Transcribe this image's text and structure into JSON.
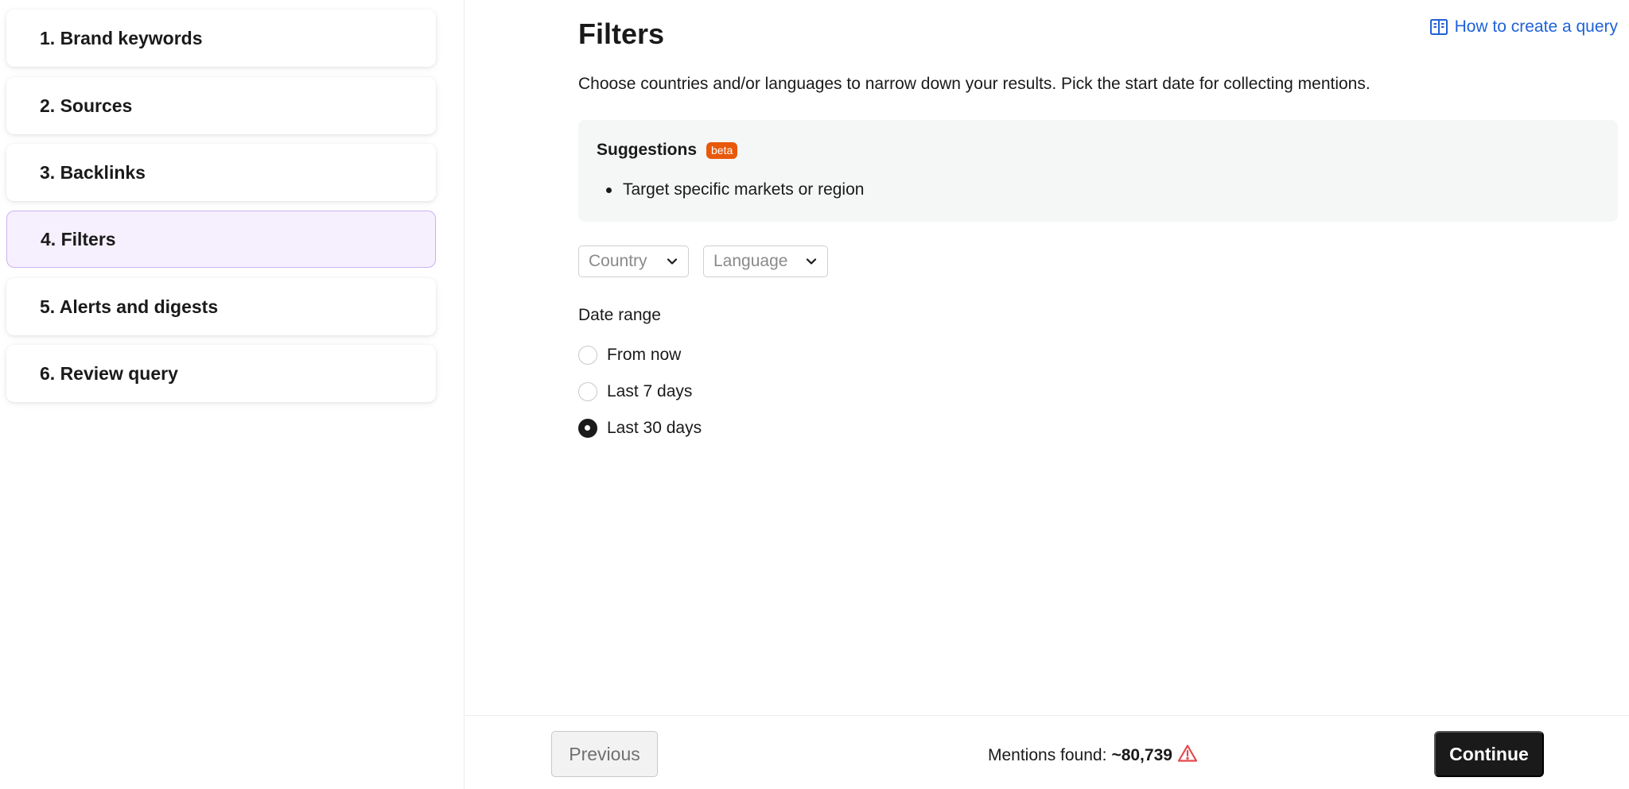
{
  "sidebar": {
    "steps": [
      {
        "label": "1. Brand keywords"
      },
      {
        "label": "2. Sources"
      },
      {
        "label": "3. Backlinks"
      },
      {
        "label": "4. Filters"
      },
      {
        "label": "5. Alerts and digests"
      },
      {
        "label": "6. Review query"
      }
    ],
    "active_step": "4. Filters"
  },
  "main": {
    "title": "Filters",
    "help_link": {
      "label": "How to create a query",
      "icon": "book-icon"
    },
    "description": "Choose countries and/or languages to narrow down your results. Pick the start date for collecting mentions.",
    "suggestions": {
      "title": "Suggestions",
      "badge": "beta",
      "items": [
        "Target specific markets or region"
      ]
    },
    "filters": {
      "country": {
        "placeholder": "Country",
        "icon": "chevron-down-icon"
      },
      "language": {
        "placeholder": "Language",
        "icon": "chevron-down-icon"
      }
    },
    "date_range": {
      "label": "Date range",
      "options": [
        {
          "label": "From now",
          "checked": false
        },
        {
          "label": "Last 7 days",
          "checked": false
        },
        {
          "label": "Last 30 days",
          "checked": true
        }
      ]
    }
  },
  "footer": {
    "previous_label": "Previous",
    "mentions_label": "Mentions found:",
    "mentions_value": "~80,739",
    "warning_icon": "warning-icon",
    "continue_label": "Continue"
  },
  "colors": {
    "accent_link": "#1f62d8",
    "beta_badge": "#e8590c",
    "active_step_bg": "#f6f0fe",
    "active_step_border": "#c9b2ef",
    "warning": "#e5484d",
    "primary_button": "#1a1a1a"
  }
}
